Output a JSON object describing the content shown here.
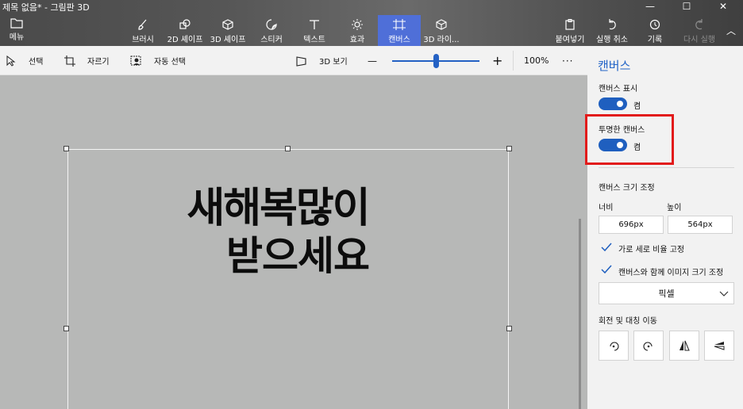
{
  "window": {
    "title": "제목 없음* - 그림판 3D",
    "minimize_glyph": "—",
    "maximize_glyph": "☐",
    "close_glyph": "✕"
  },
  "ribbon": {
    "menu_label": "메뉴",
    "tools": [
      {
        "label": "브러시",
        "icon": "brush-icon"
      },
      {
        "label": "2D 셰이프",
        "icon": "2d-shapes-icon"
      },
      {
        "label": "3D 셰이프",
        "icon": "3d-shapes-icon"
      },
      {
        "label": "스티커",
        "icon": "stickers-icon"
      },
      {
        "label": "텍스트",
        "icon": "text-icon"
      },
      {
        "label": "효과",
        "icon": "effects-icon"
      },
      {
        "label": "캔버스",
        "icon": "canvas-icon",
        "active": true
      },
      {
        "label": "3D 라이...",
        "icon": "3d-library-icon"
      }
    ],
    "actions": [
      {
        "label": "붙여넣기",
        "icon": "paste-icon"
      },
      {
        "label": "실행 취소",
        "icon": "undo-icon"
      },
      {
        "label": "기록",
        "icon": "history-icon"
      },
      {
        "label": "다시 실행",
        "icon": "redo-icon",
        "disabled": true
      }
    ],
    "collapse_glyph": "︿"
  },
  "toolbar": {
    "select_label": "선택",
    "crop_label": "자르기",
    "magic_select_label": "자동 선택",
    "view3d_label": "3D 보기",
    "zoom_minus": "—",
    "zoom_plus": "+",
    "zoom_level": 0.5,
    "zoom_value": "100%",
    "more_glyph": "···"
  },
  "canvas": {
    "text_line1": "새해복많이",
    "text_line2": "받으세요"
  },
  "panel": {
    "title": "캔버스",
    "show_canvas_label": "캔버스 표시",
    "show_canvas_state": "켬",
    "transparent_canvas_label": "투명한 캔버스",
    "transparent_canvas_state": "켬",
    "resize_heading": "캔버스 크기 조정",
    "width_label": "너비",
    "height_label": "높이",
    "width_value": "696px",
    "height_value": "564px",
    "lock_ratio_label": "가로 세로 비율 고정",
    "resize_image_label": "캔버스와 함께 이미지 크기 조정",
    "unit_value": "픽셀",
    "rotate_flip_heading": "회전 및 대칭 이동"
  },
  "colors": {
    "accent": "#2264c7",
    "active_tool": "#4f6fd8",
    "highlight": "#e21b1b",
    "workspace": "#b7b8b7"
  }
}
